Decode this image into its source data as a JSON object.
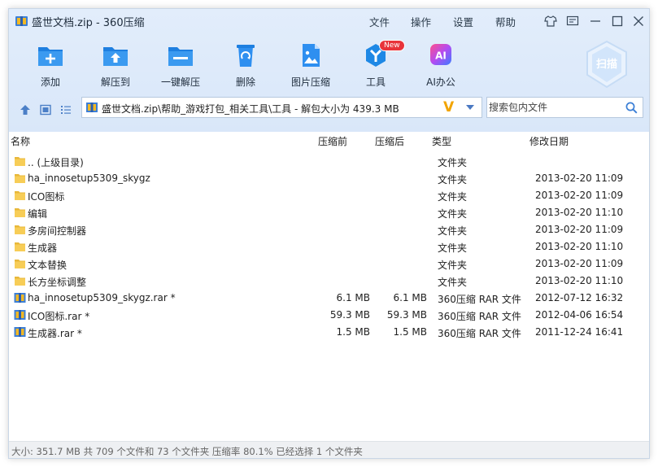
{
  "window": {
    "title": "盛世文档.zip - 360压缩"
  },
  "menu": [
    "文件",
    "操作",
    "设置",
    "帮助"
  ],
  "toolbar": {
    "items": [
      {
        "label": "添加",
        "icon": "add-folder-icon"
      },
      {
        "label": "解压到",
        "icon": "extract-to-icon"
      },
      {
        "label": "一键解压",
        "icon": "one-click-extract-icon"
      },
      {
        "label": "删除",
        "icon": "recycle-bin-icon"
      },
      {
        "label": "图片压缩",
        "icon": "image-compress-icon"
      },
      {
        "label": "工具",
        "icon": "tools-icon",
        "badge": "New"
      },
      {
        "label": "AI办公",
        "icon": "ai-icon",
        "icon_text": "AI"
      }
    ],
    "scan_label": "扫描"
  },
  "path": {
    "text": "盛世文档.zip\\帮助_游戏打包_相关工具\\工具 - 解包大小为 439.3 MB",
    "mark": "V"
  },
  "search": {
    "placeholder": "搜索包内文件"
  },
  "columns": {
    "name": "名称",
    "before": "压缩前",
    "after": "压缩后",
    "type": "类型",
    "date": "修改日期"
  },
  "rows": [
    {
      "name": ".. (上级目录)",
      "before": "",
      "after": "",
      "type": "文件夹",
      "date": "",
      "kind": "folder"
    },
    {
      "name": "ha_innosetup5309_skygz",
      "before": "",
      "after": "",
      "type": "文件夹",
      "date": "2013-02-20 11:09",
      "kind": "folder"
    },
    {
      "name": "ICO图标",
      "before": "",
      "after": "",
      "type": "文件夹",
      "date": "2013-02-20 11:09",
      "kind": "folder"
    },
    {
      "name": "编辑",
      "before": "",
      "after": "",
      "type": "文件夹",
      "date": "2013-02-20 11:10",
      "kind": "folder"
    },
    {
      "name": "多房间控制器",
      "before": "",
      "after": "",
      "type": "文件夹",
      "date": "2013-02-20 11:09",
      "kind": "folder"
    },
    {
      "name": "生成器",
      "before": "",
      "after": "",
      "type": "文件夹",
      "date": "2013-02-20 11:10",
      "kind": "folder"
    },
    {
      "name": "文本替换",
      "before": "",
      "after": "",
      "type": "文件夹",
      "date": "2013-02-20 11:09",
      "kind": "folder"
    },
    {
      "name": "长方坐标调整",
      "before": "",
      "after": "",
      "type": "文件夹",
      "date": "2013-02-20 11:10",
      "kind": "folder"
    },
    {
      "name": "ha_innosetup5309_skygz.rar *",
      "before": "6.1 MB",
      "after": "6.1 MB",
      "type": "360压缩 RAR 文件",
      "date": "2012-07-12 16:32",
      "kind": "rar"
    },
    {
      "name": "ICO图标.rar *",
      "before": "59.3 MB",
      "after": "59.3 MB",
      "type": "360压缩 RAR 文件",
      "date": "2012-04-06 16:54",
      "kind": "rar"
    },
    {
      "name": "生成器.rar *",
      "before": "1.5 MB",
      "after": "1.5 MB",
      "type": "360压缩 RAR 文件",
      "date": "2011-12-24 16:41",
      "kind": "rar"
    }
  ],
  "status": "大小: 351.7 MB 共 709 个文件和 73 个文件夹 压缩率 80.1% 已经选择 1 个文件夹",
  "colors": {
    "accent": "#1e88e5",
    "folder": "#f7c94c",
    "header_bg": "#dde9fa"
  }
}
